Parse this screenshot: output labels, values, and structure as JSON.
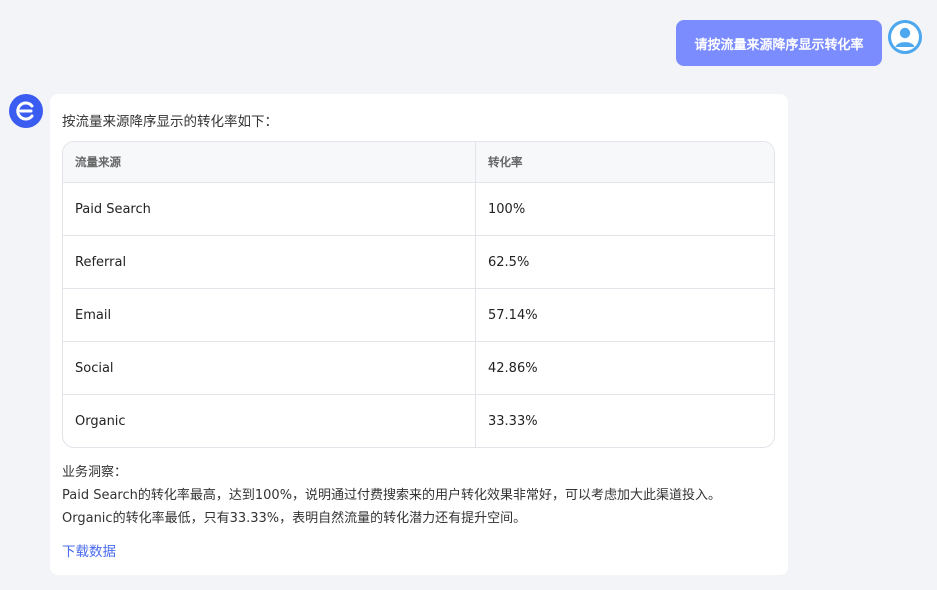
{
  "user_message": {
    "text": "请按流量来源降序显示转化率"
  },
  "assistant": {
    "intro": "按流量来源降序显示的转化率如下：",
    "table": {
      "headers": [
        "流量来源",
        "转化率"
      ],
      "rows": [
        [
          "Paid Search",
          "100%"
        ],
        [
          "Referral",
          "62.5%"
        ],
        [
          "Email",
          "57.14%"
        ],
        [
          "Social",
          "42.86%"
        ],
        [
          "Organic",
          "33.33%"
        ]
      ]
    },
    "insight_title": "业务洞察：",
    "insight_line1": "Paid Search的转化率最高，达到100%，说明通过付费搜索来的用户转化效果非常好，可以考虑加大此渠道投入。",
    "insight_line2": "Organic的转化率最低，只有33.33%，表明自然流量的转化潜力还有提升空间。",
    "download_label": "下载数据"
  },
  "colors": {
    "user_bubble": "#7b8cff",
    "bot_avatar": "#3b5cf0",
    "user_avatar": "#4ea8ee",
    "link": "#4a6cf0"
  },
  "icons": {
    "user_avatar": "user-avatar-icon",
    "bot_avatar": "bot-logo-icon"
  }
}
